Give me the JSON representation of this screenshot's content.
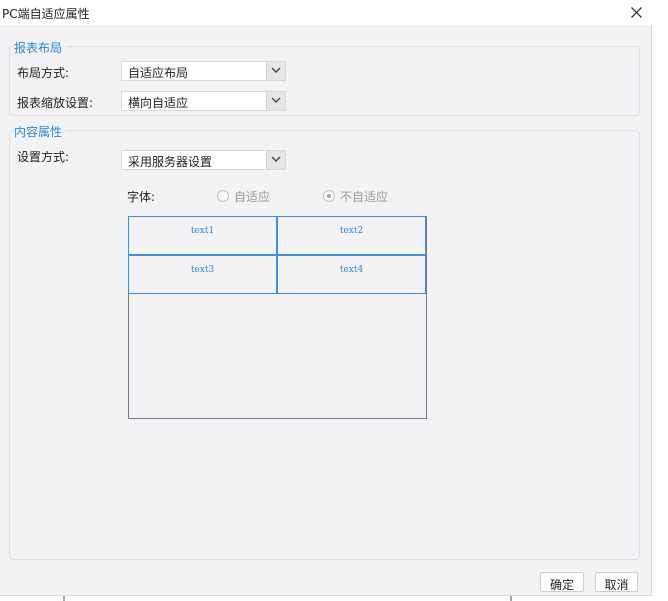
{
  "window": {
    "title": "PC端自适应属性",
    "close_icon": "close-icon"
  },
  "layout_group": {
    "title": "报表布局",
    "layout_mode": {
      "label": "布局方式:",
      "value": "自适应布局"
    },
    "scale_setting": {
      "label": "报表缩放设置:",
      "value": "横向自适应"
    }
  },
  "content_group": {
    "title": "内容属性",
    "setting_mode": {
      "label": "设置方式:",
      "value": "采用服务器设置"
    },
    "font": {
      "label": "字体:",
      "options": [
        {
          "label": "自适应",
          "checked": false
        },
        {
          "label": "不自适应",
          "checked": true
        }
      ]
    },
    "preview_cells": [
      "text1",
      "text2",
      "text3",
      "text4"
    ]
  },
  "footer": {
    "ok_label": "确定",
    "cancel_label": "取消"
  },
  "colors": {
    "accent": "#2b8ad6",
    "cell_border": "#3d8fe0",
    "background": "#f3f3f5"
  }
}
